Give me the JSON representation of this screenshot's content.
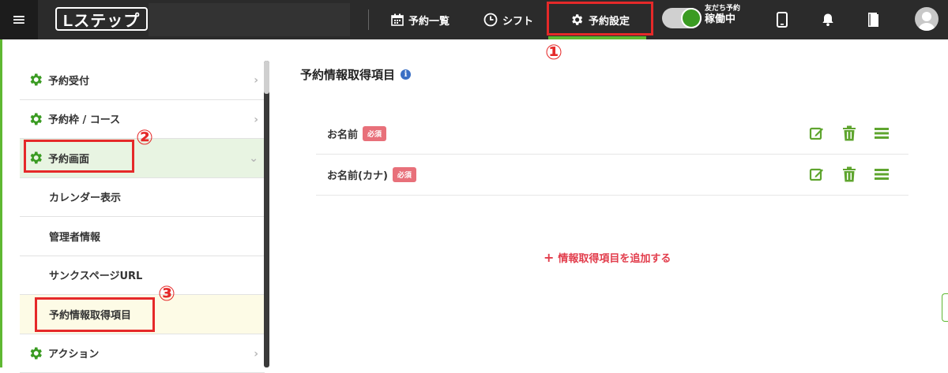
{
  "topbar": {
    "menu_icon": "hamburger-icon",
    "logo_text": "Lステップ",
    "logo_mark": "®",
    "nav": [
      {
        "label": "予約一覧",
        "icon": "calendar-icon"
      },
      {
        "label": "シフト",
        "icon": "clock-icon"
      },
      {
        "label": "予約設定",
        "icon": "gear-icon"
      }
    ],
    "toggle": {
      "top_label": "友だち予約",
      "state_label": "稼働中",
      "on": true
    },
    "icons": [
      "phone-icon",
      "bell-icon",
      "book-icon",
      "avatar-icon"
    ],
    "accent_color": "#5fb832"
  },
  "annotations": {
    "callout_1": "①",
    "callout_2": "②",
    "callout_3": "③",
    "color": "#e52929"
  },
  "sidebar": {
    "items": [
      {
        "label": "予約受付",
        "icon": "gear-icon",
        "chevron": "›"
      },
      {
        "label": "予約枠 / コース",
        "icon": "gear-icon",
        "chevron": "›"
      },
      {
        "label": "予約画面",
        "icon": "gear-icon",
        "chevron": "⌄",
        "expanded": true
      },
      {
        "label": "カレンダー表示"
      },
      {
        "label": "管理者情報"
      },
      {
        "label": "サンクスページURL"
      },
      {
        "label": "予約情報取得項目",
        "current": true
      },
      {
        "label": "アクション",
        "icon": "gear-icon",
        "chevron": "›"
      }
    ]
  },
  "main": {
    "title": "予約情報取得項目",
    "info_icon": "i",
    "rows": [
      {
        "label": "お名前",
        "badge": "必須"
      },
      {
        "label": "お名前(カナ)",
        "badge": "必須"
      }
    ],
    "add_link_plus": "+",
    "add_link": "情報取得項目を追加する",
    "required_color": "#e8707a",
    "link_color": "#e23d4c"
  }
}
